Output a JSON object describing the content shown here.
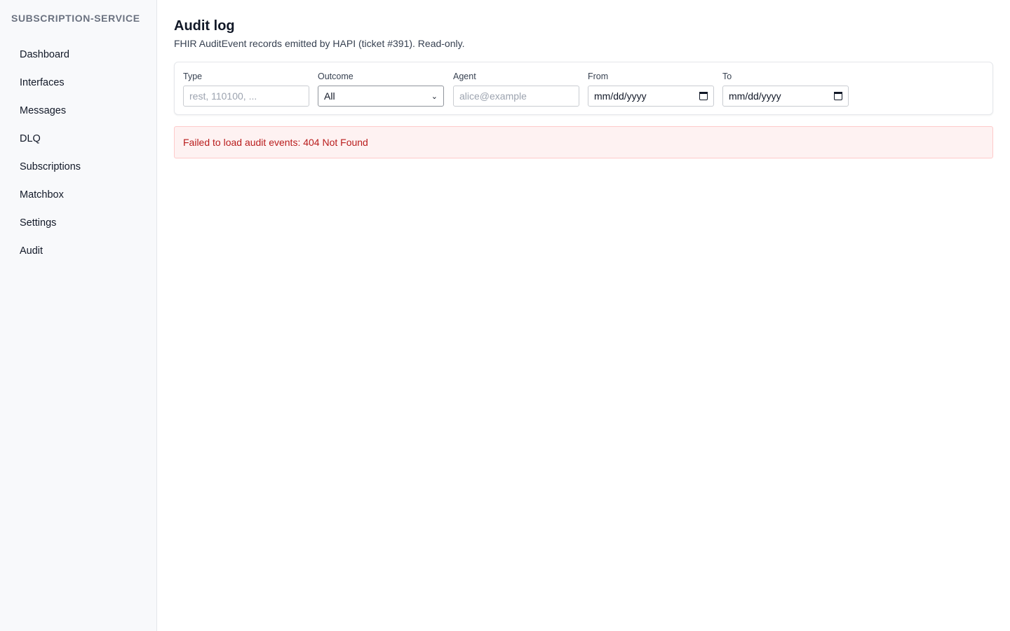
{
  "app": {
    "brand": "SUBSCRIPTION-SERVICE"
  },
  "sidebar": {
    "items": [
      {
        "label": "Dashboard"
      },
      {
        "label": "Interfaces"
      },
      {
        "label": "Messages"
      },
      {
        "label": "DLQ"
      },
      {
        "label": "Subscriptions"
      },
      {
        "label": "Matchbox"
      },
      {
        "label": "Settings"
      },
      {
        "label": "Audit"
      }
    ]
  },
  "page": {
    "title": "Audit log",
    "subtitle": "FHIR AuditEvent records emitted by HAPI (ticket #391). Read-only."
  },
  "filters": {
    "type": {
      "label": "Type",
      "placeholder": "rest, 110100, ..."
    },
    "outcome": {
      "label": "Outcome",
      "value": "All"
    },
    "agent": {
      "label": "Agent",
      "placeholder": "alice@example"
    },
    "from": {
      "label": "From",
      "placeholder": "mm/dd/yyyy",
      "icon": "calendar-icon"
    },
    "to": {
      "label": "To",
      "placeholder": "mm/dd/yyyy",
      "icon": "calendar-icon"
    }
  },
  "error": {
    "message": "Failed to load audit events: 404 Not Found"
  },
  "colors": {
    "sidebar_bg": "#f8f9fb",
    "error_bg": "#fef2f2",
    "error_text": "#b91c1c"
  }
}
